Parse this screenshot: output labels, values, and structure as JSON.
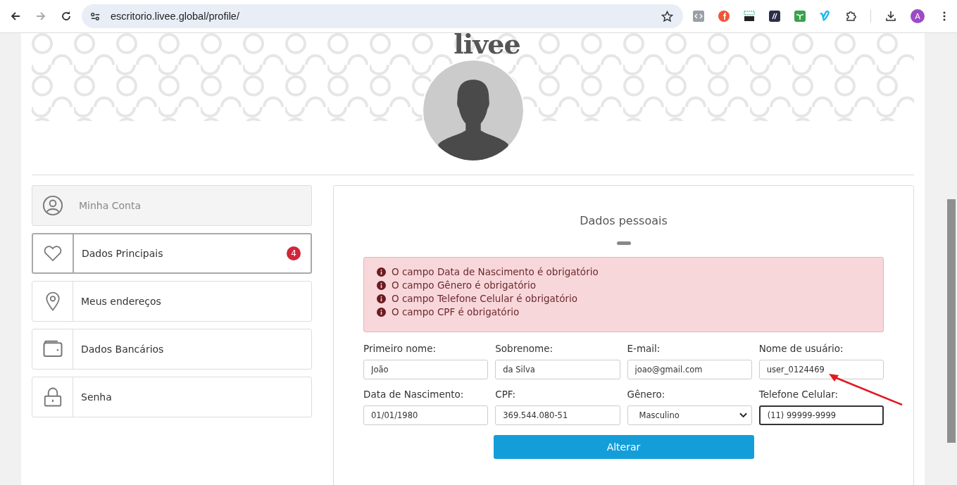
{
  "browser": {
    "url": "escritorio.livee.global/profile/",
    "profile_initial": "A"
  },
  "header": {
    "logo": "livee"
  },
  "sidebar": {
    "items": [
      {
        "kind": "header",
        "label": "Minha Conta",
        "selected": false
      },
      {
        "kind": "item",
        "label": "Dados Principais",
        "selected": true,
        "badge": "4"
      },
      {
        "kind": "item",
        "label": "Meus endereços",
        "selected": false
      },
      {
        "kind": "item",
        "label": "Dados Bancários",
        "selected": false
      },
      {
        "kind": "item",
        "label": "Senha",
        "selected": false
      }
    ]
  },
  "form": {
    "title": "Dados pessoais",
    "errors": [
      "O campo Data de Nascimento é obrigatório",
      "O campo Gênero é obrigatório",
      "O campo Telefone Celular é obrigatório",
      "O campo CPF é obrigatório"
    ],
    "fields": [
      {
        "kind": "text",
        "label": "Primeiro nome:",
        "value": "João",
        "focused": false
      },
      {
        "kind": "text",
        "label": "Sobrenome:",
        "value": "da Silva",
        "focused": false
      },
      {
        "kind": "text",
        "label": "E-mail:",
        "value": "joao@gmail.com",
        "focused": false
      },
      {
        "kind": "text",
        "label": "Nome de usuário:",
        "value": "user_0124469",
        "focused": false
      },
      {
        "kind": "text",
        "label": "Data de Nascimento:",
        "value": "01/01/1980",
        "focused": false
      },
      {
        "kind": "text",
        "label": "CPF:",
        "value": "369.544.080-51",
        "focused": false
      },
      {
        "kind": "select",
        "label": "Gênero:",
        "value": "Masculino",
        "focused": false
      },
      {
        "kind": "text",
        "label": "Telefone Celular:",
        "value": "(11) 99999-9999",
        "focused": true
      }
    ],
    "submit": "Alterar"
  }
}
